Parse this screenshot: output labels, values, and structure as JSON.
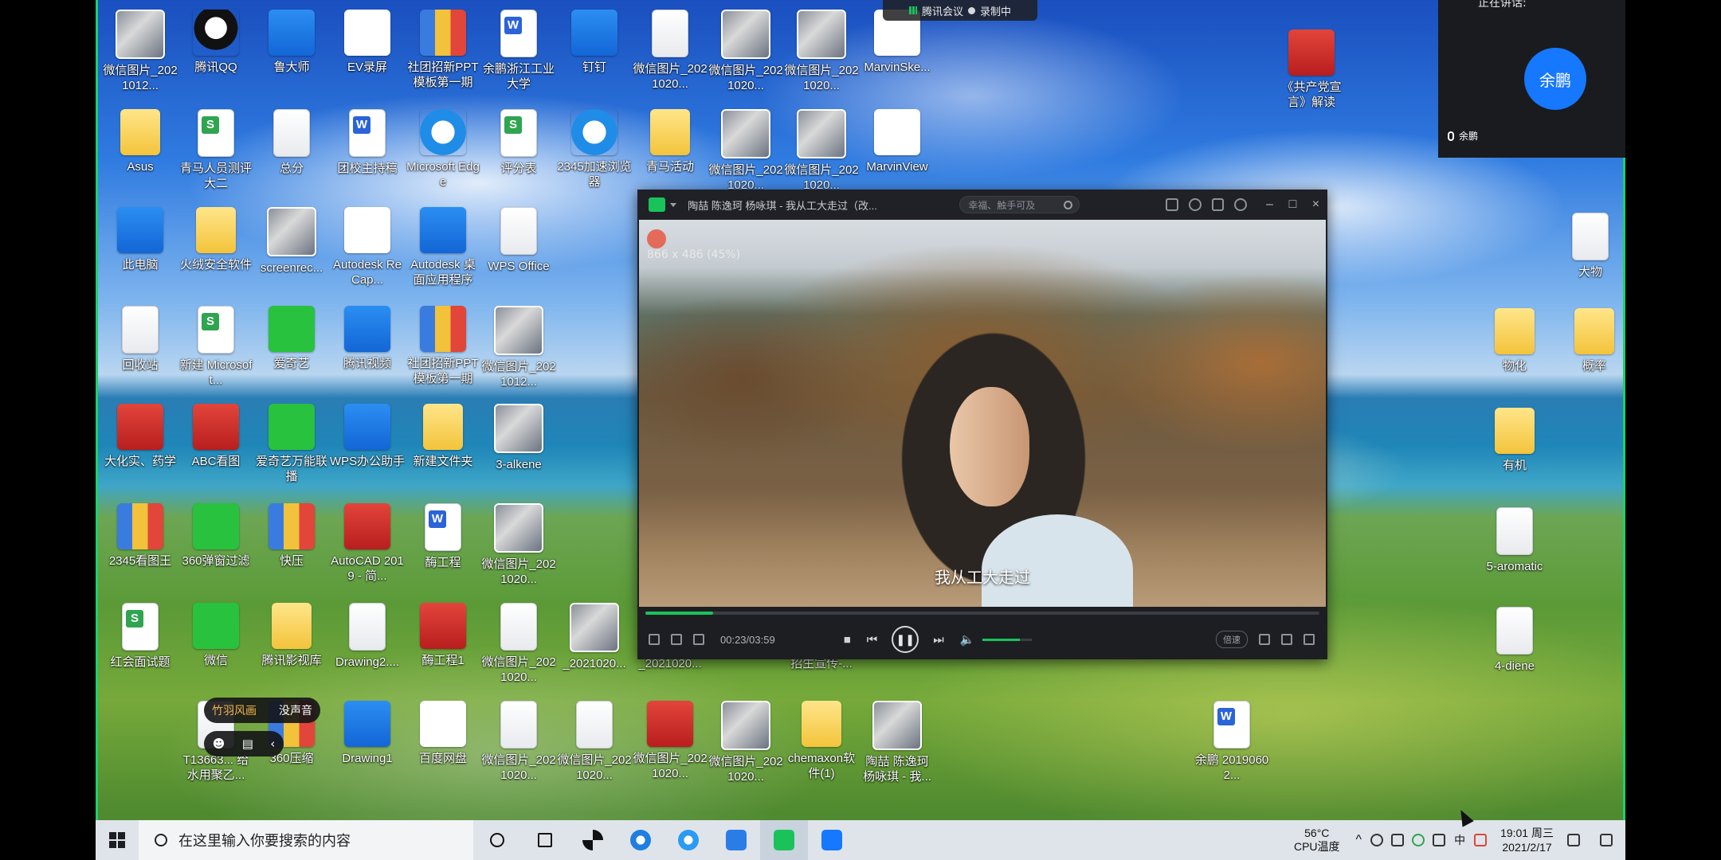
{
  "desktop_icons": [
    {
      "label": "微信图片_2021012...",
      "kind": "photo"
    },
    {
      "label": "腾讯QQ",
      "kind": "qq"
    },
    {
      "label": "鲁大师",
      "kind": "blue"
    },
    {
      "label": "EV录屏",
      "kind": "white"
    },
    {
      "label": "社团招新PPT模板第一期",
      "kind": "zip"
    },
    {
      "label": "余鹏浙江工业大学",
      "kind": "word"
    },
    {
      "label": "钉钉",
      "kind": "blue"
    },
    {
      "label": "微信图片_2021020...",
      "kind": "doc"
    },
    {
      "label": "微信图片_2021020...",
      "kind": "photo"
    },
    {
      "label": "微信图片_2021020...",
      "kind": "photo"
    },
    {
      "label": "MarvinSke...",
      "kind": "white"
    },
    {
      "label": "Asus",
      "kind": "folder"
    },
    {
      "label": "青马人员测评大二",
      "kind": "excel"
    },
    {
      "label": "总分",
      "kind": "doc"
    },
    {
      "label": "团校主持稿",
      "kind": "word"
    },
    {
      "label": "Microsoft Edge",
      "kind": "ie"
    },
    {
      "label": "评分表",
      "kind": "excel"
    },
    {
      "label": "2345加速浏览器",
      "kind": "ie"
    },
    {
      "label": "青马活动",
      "kind": "folder"
    },
    {
      "label": "微信图片_2021020...",
      "kind": "photo"
    },
    {
      "label": "微信图片_2021020...",
      "kind": "photo"
    },
    {
      "label": "MarvinView",
      "kind": "white"
    },
    {
      "label": "此电脑",
      "kind": "blue"
    },
    {
      "label": "火绒安全软件",
      "kind": "folder"
    },
    {
      "label": "screenrec...",
      "kind": "photo"
    },
    {
      "label": "Autodesk ReCap...",
      "kind": "white"
    },
    {
      "label": "Autodesk 桌面应用程序",
      "kind": "blue"
    },
    {
      "label": "WPS Office",
      "kind": "doc"
    },
    {
      "label": "回收站",
      "kind": "doc"
    },
    {
      "label": "新建 Microsoft...",
      "kind": "excel"
    },
    {
      "label": "爱奇艺",
      "kind": "green"
    },
    {
      "label": "腾讯视频",
      "kind": "blue"
    },
    {
      "label": "社团招新PPT模板第一期",
      "kind": "zip"
    },
    {
      "label": "微信图片_2021012...",
      "kind": "photo"
    },
    {
      "label": "大化实、药学",
      "kind": "red"
    },
    {
      "label": "ABC看图",
      "kind": "red"
    },
    {
      "label": "爱奇艺万能联播",
      "kind": "green"
    },
    {
      "label": "WPS办公助手",
      "kind": "blue"
    },
    {
      "label": "新建文件夹",
      "kind": "folder"
    },
    {
      "label": "3-alkene",
      "kind": "photo"
    },
    {
      "label": "2345看图王",
      "kind": "zip"
    },
    {
      "label": "360弹窗过滤",
      "kind": "green"
    },
    {
      "label": "快压",
      "kind": "zip"
    },
    {
      "label": "AutoCAD 2019 - 简...",
      "kind": "red"
    },
    {
      "label": "酶工程",
      "kind": "word"
    },
    {
      "label": "微信图片_2021020...",
      "kind": "photo"
    },
    {
      "label": "红会面试题",
      "kind": "excel"
    },
    {
      "label": "微信",
      "kind": "green"
    },
    {
      "label": "腾讯影视库",
      "kind": "folder"
    },
    {
      "label": "Drawing2....",
      "kind": "doc"
    },
    {
      "label": "酶工程1",
      "kind": "red"
    },
    {
      "label": "微信图片_2021020...",
      "kind": "doc"
    },
    {
      "label": "_2021020...",
      "kind": "photo"
    },
    {
      "label": "_2021020...",
      "kind": "photo"
    },
    {
      "label": "招生宣传-...",
      "kind": "photo"
    },
    {
      "label": "T13663... 给水用聚乙...",
      "kind": "doc"
    },
    {
      "label": "360压缩",
      "kind": "zip"
    },
    {
      "label": "Drawing1",
      "kind": "blue"
    },
    {
      "label": "百度网盘",
      "kind": "white"
    },
    {
      "label": "微信图片_2021020...",
      "kind": "doc"
    },
    {
      "label": "微信图片_2021020...",
      "kind": "doc"
    },
    {
      "label": "微信图片_2021020...",
      "kind": "red"
    },
    {
      "label": "微信图片_2021020...",
      "kind": "photo"
    },
    {
      "label": "chemaxon软件(1)",
      "kind": "folder"
    },
    {
      "label": "陶喆 陈逸珂 杨咏琪 - 我...",
      "kind": "photo"
    },
    {
      "label": "余鹏 20190602...",
      "kind": "word"
    },
    {
      "label": "《共产党宣言》解读",
      "kind": "red"
    },
    {
      "label": "大物",
      "kind": "doc"
    },
    {
      "label": "物化",
      "kind": "folder"
    },
    {
      "label": "概率",
      "kind": "folder"
    },
    {
      "label": "有机",
      "kind": "folder"
    },
    {
      "label": "5-aromatic",
      "kind": "doc"
    },
    {
      "label": "4-diene",
      "kind": "doc"
    }
  ],
  "meeting": {
    "bar_title": "腾讯会议",
    "recording": "录制中",
    "speaking_label": "正在讲话:",
    "avatar_name": "余鹏",
    "participant": "余鹏"
  },
  "player": {
    "title": "陶喆 陈逸珂 杨咏琪 - 我从工大走过（改...",
    "search_placeholder": "幸福、触手可及",
    "overlay_line": "866 x 486 (45%)",
    "subtitle": "我从工大走过",
    "time": "00:23/03:59",
    "progress": 0.1,
    "volume": 0.75,
    "speed_label": "倍速",
    "accent": "#19c35a"
  },
  "danmaku": {
    "tab_active": "竹羽风画",
    "tab_other": "没声音"
  },
  "taskbar": {
    "search_placeholder": "在这里输入你要搜索的内容",
    "temp": "56°C",
    "temp_label": "CPU温度",
    "ime": "中",
    "time": "19:01 周三",
    "date": "2021/2/17"
  }
}
